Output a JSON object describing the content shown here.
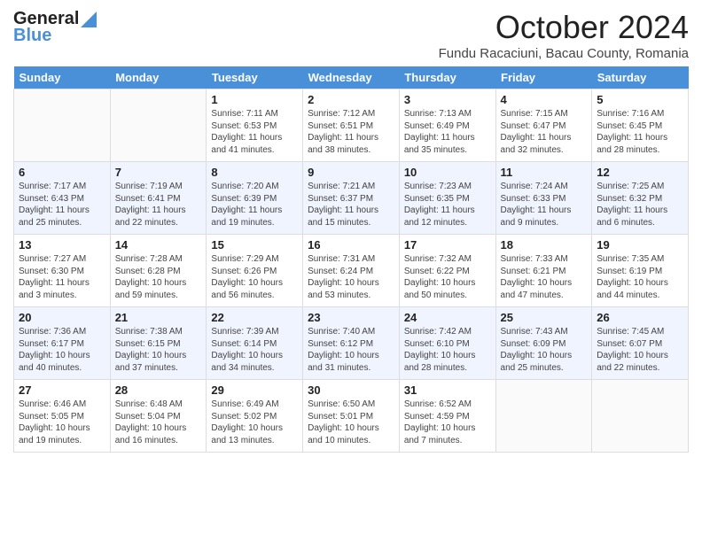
{
  "header": {
    "logo_general": "General",
    "logo_blue": "Blue",
    "month_title": "October 2024",
    "location": "Fundu Racaciuni, Bacau County, Romania"
  },
  "days_of_week": [
    "Sunday",
    "Monday",
    "Tuesday",
    "Wednesday",
    "Thursday",
    "Friday",
    "Saturday"
  ],
  "weeks": [
    [
      {
        "day": "",
        "info": ""
      },
      {
        "day": "",
        "info": ""
      },
      {
        "day": "1",
        "info": "Sunrise: 7:11 AM\nSunset: 6:53 PM\nDaylight: 11 hours and 41 minutes."
      },
      {
        "day": "2",
        "info": "Sunrise: 7:12 AM\nSunset: 6:51 PM\nDaylight: 11 hours and 38 minutes."
      },
      {
        "day": "3",
        "info": "Sunrise: 7:13 AM\nSunset: 6:49 PM\nDaylight: 11 hours and 35 minutes."
      },
      {
        "day": "4",
        "info": "Sunrise: 7:15 AM\nSunset: 6:47 PM\nDaylight: 11 hours and 32 minutes."
      },
      {
        "day": "5",
        "info": "Sunrise: 7:16 AM\nSunset: 6:45 PM\nDaylight: 11 hours and 28 minutes."
      }
    ],
    [
      {
        "day": "6",
        "info": "Sunrise: 7:17 AM\nSunset: 6:43 PM\nDaylight: 11 hours and 25 minutes."
      },
      {
        "day": "7",
        "info": "Sunrise: 7:19 AM\nSunset: 6:41 PM\nDaylight: 11 hours and 22 minutes."
      },
      {
        "day": "8",
        "info": "Sunrise: 7:20 AM\nSunset: 6:39 PM\nDaylight: 11 hours and 19 minutes."
      },
      {
        "day": "9",
        "info": "Sunrise: 7:21 AM\nSunset: 6:37 PM\nDaylight: 11 hours and 15 minutes."
      },
      {
        "day": "10",
        "info": "Sunrise: 7:23 AM\nSunset: 6:35 PM\nDaylight: 11 hours and 12 minutes."
      },
      {
        "day": "11",
        "info": "Sunrise: 7:24 AM\nSunset: 6:33 PM\nDaylight: 11 hours and 9 minutes."
      },
      {
        "day": "12",
        "info": "Sunrise: 7:25 AM\nSunset: 6:32 PM\nDaylight: 11 hours and 6 minutes."
      }
    ],
    [
      {
        "day": "13",
        "info": "Sunrise: 7:27 AM\nSunset: 6:30 PM\nDaylight: 11 hours and 3 minutes."
      },
      {
        "day": "14",
        "info": "Sunrise: 7:28 AM\nSunset: 6:28 PM\nDaylight: 10 hours and 59 minutes."
      },
      {
        "day": "15",
        "info": "Sunrise: 7:29 AM\nSunset: 6:26 PM\nDaylight: 10 hours and 56 minutes."
      },
      {
        "day": "16",
        "info": "Sunrise: 7:31 AM\nSunset: 6:24 PM\nDaylight: 10 hours and 53 minutes."
      },
      {
        "day": "17",
        "info": "Sunrise: 7:32 AM\nSunset: 6:22 PM\nDaylight: 10 hours and 50 minutes."
      },
      {
        "day": "18",
        "info": "Sunrise: 7:33 AM\nSunset: 6:21 PM\nDaylight: 10 hours and 47 minutes."
      },
      {
        "day": "19",
        "info": "Sunrise: 7:35 AM\nSunset: 6:19 PM\nDaylight: 10 hours and 44 minutes."
      }
    ],
    [
      {
        "day": "20",
        "info": "Sunrise: 7:36 AM\nSunset: 6:17 PM\nDaylight: 10 hours and 40 minutes."
      },
      {
        "day": "21",
        "info": "Sunrise: 7:38 AM\nSunset: 6:15 PM\nDaylight: 10 hours and 37 minutes."
      },
      {
        "day": "22",
        "info": "Sunrise: 7:39 AM\nSunset: 6:14 PM\nDaylight: 10 hours and 34 minutes."
      },
      {
        "day": "23",
        "info": "Sunrise: 7:40 AM\nSunset: 6:12 PM\nDaylight: 10 hours and 31 minutes."
      },
      {
        "day": "24",
        "info": "Sunrise: 7:42 AM\nSunset: 6:10 PM\nDaylight: 10 hours and 28 minutes."
      },
      {
        "day": "25",
        "info": "Sunrise: 7:43 AM\nSunset: 6:09 PM\nDaylight: 10 hours and 25 minutes."
      },
      {
        "day": "26",
        "info": "Sunrise: 7:45 AM\nSunset: 6:07 PM\nDaylight: 10 hours and 22 minutes."
      }
    ],
    [
      {
        "day": "27",
        "info": "Sunrise: 6:46 AM\nSunset: 5:05 PM\nDaylight: 10 hours and 19 minutes."
      },
      {
        "day": "28",
        "info": "Sunrise: 6:48 AM\nSunset: 5:04 PM\nDaylight: 10 hours and 16 minutes."
      },
      {
        "day": "29",
        "info": "Sunrise: 6:49 AM\nSunset: 5:02 PM\nDaylight: 10 hours and 13 minutes."
      },
      {
        "day": "30",
        "info": "Sunrise: 6:50 AM\nSunset: 5:01 PM\nDaylight: 10 hours and 10 minutes."
      },
      {
        "day": "31",
        "info": "Sunrise: 6:52 AM\nSunset: 4:59 PM\nDaylight: 10 hours and 7 minutes."
      },
      {
        "day": "",
        "info": ""
      },
      {
        "day": "",
        "info": ""
      }
    ]
  ]
}
